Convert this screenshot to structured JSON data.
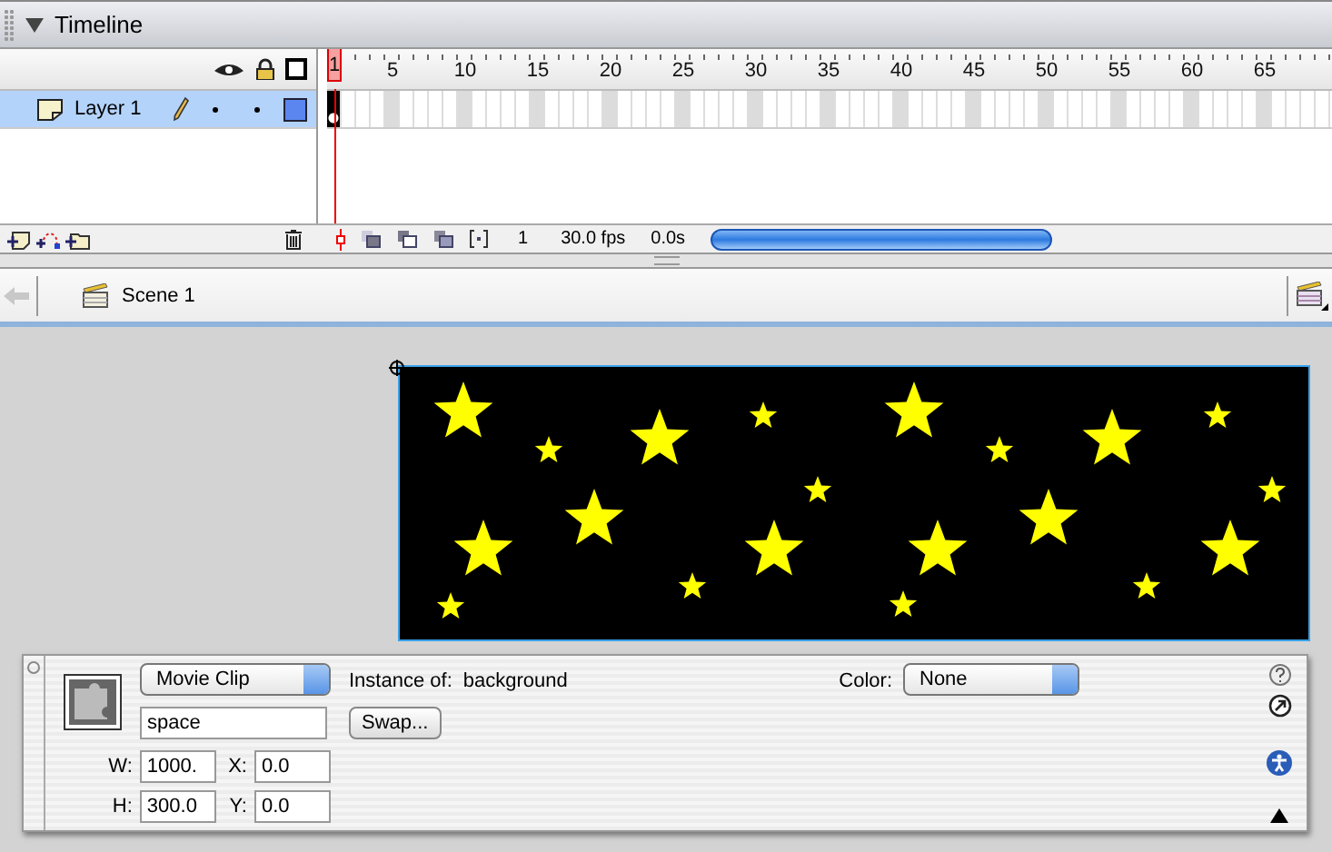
{
  "panel": {
    "title": "Timeline",
    "expanded": true
  },
  "ruler": [
    {
      "label": "1",
      "selected": true
    },
    {
      "label": "5",
      "selected": false
    },
    {
      "label": "10",
      "selected": false
    },
    {
      "label": "15",
      "selected": false
    },
    {
      "label": "20",
      "selected": false
    },
    {
      "label": "25",
      "selected": false
    },
    {
      "label": "30",
      "selected": false
    },
    {
      "label": "35",
      "selected": false
    },
    {
      "label": "40",
      "selected": false
    },
    {
      "label": "45",
      "selected": false
    },
    {
      "label": "50",
      "selected": false
    },
    {
      "label": "55",
      "selected": false
    },
    {
      "label": "60",
      "selected": false
    },
    {
      "label": "65",
      "selected": false
    }
  ],
  "layers": [
    {
      "name": "Layer 1",
      "selected": true
    }
  ],
  "status": {
    "frame": "1",
    "rate": "30.0 fps",
    "time": "0.0s"
  },
  "scene": {
    "name": "Scene 1"
  },
  "properties": {
    "symbol_type": "Movie Clip",
    "instance_name": "space",
    "instance_of_label": "Instance of:",
    "instance_of": "background",
    "swap": "Swap...",
    "color_label": "Color:",
    "color_effect": "None",
    "fields": [
      {
        "label": "W:",
        "value": "1000."
      },
      {
        "label": "X:",
        "value": "0.0"
      },
      {
        "label": "H:",
        "value": "300.0"
      },
      {
        "label": "Y:",
        "value": "0.0"
      }
    ]
  }
}
